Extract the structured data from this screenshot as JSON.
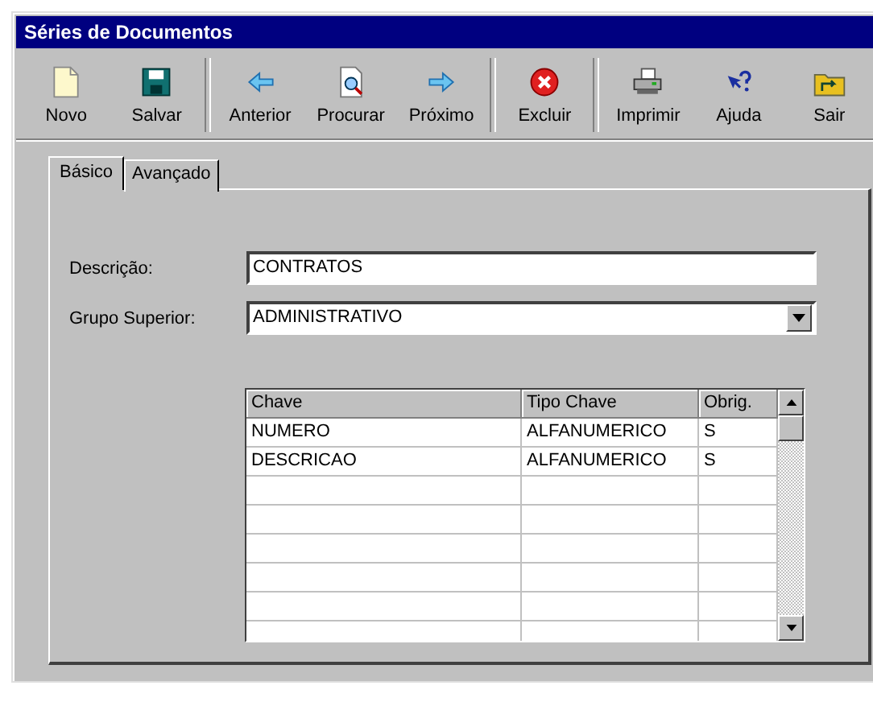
{
  "window": {
    "title": "Séries de Documentos"
  },
  "toolbar": {
    "groups": [
      [
        {
          "label": "Novo",
          "kind": "new"
        },
        {
          "label": "Salvar",
          "kind": "save"
        }
      ],
      [
        {
          "label": "Anterior",
          "kind": "prev"
        },
        {
          "label": "Procurar",
          "kind": "find"
        },
        {
          "label": "Próximo",
          "kind": "next"
        }
      ],
      [
        {
          "label": "Excluir",
          "kind": "delete"
        }
      ],
      [
        {
          "label": "Imprimir",
          "kind": "print"
        },
        {
          "label": "Ajuda",
          "kind": "help"
        },
        {
          "label": "Sair",
          "kind": "exit"
        }
      ]
    ]
  },
  "tabs": [
    {
      "label": "Básico",
      "selected": true
    },
    {
      "label": "Avançado",
      "selected": false
    }
  ],
  "form": {
    "fields": [
      {
        "label": "Descrição:",
        "value": "CONTRATOS",
        "kind": "text"
      },
      {
        "label": "Grupo Superior:",
        "value": "ADMINISTRATIVO",
        "kind": "combo"
      }
    ]
  },
  "table": {
    "columns": [
      "Chave",
      "Tipo Chave",
      "Obrig."
    ],
    "rows": [
      [
        "NUMERO",
        "ALFANUMERICO",
        "S"
      ],
      [
        "DESCRICAO",
        "ALFANUMERICO",
        "S"
      ]
    ]
  }
}
